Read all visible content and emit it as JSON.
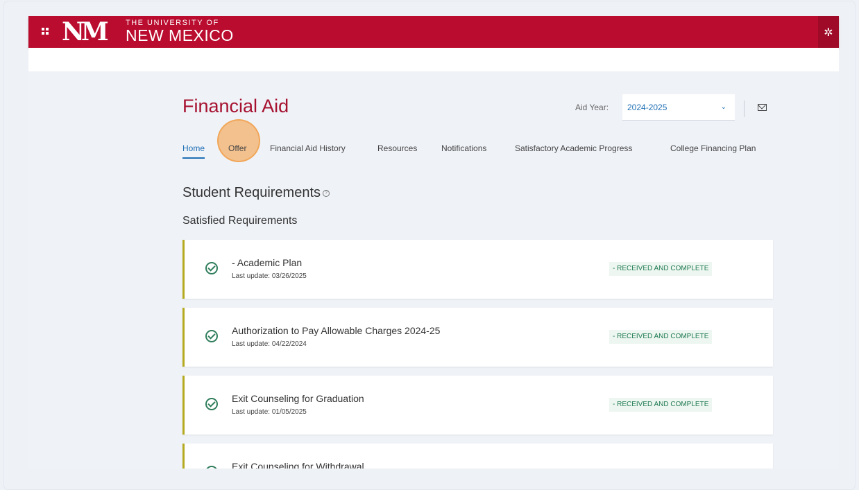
{
  "header": {
    "logo_mark": "NM",
    "logo_small": "THE UNIVERSITY OF",
    "logo_big": "NEW MEXICO"
  },
  "page": {
    "title": "Financial Aid",
    "aid_year_label": "Aid Year:",
    "aid_year_value": "2024-2025"
  },
  "tabs": [
    {
      "label": "Home",
      "active": true
    },
    {
      "label": "Offer",
      "active": false
    },
    {
      "label": "Financial Aid History",
      "active": false
    },
    {
      "label": "Resources",
      "active": false
    },
    {
      "label": "Notifications",
      "active": false
    },
    {
      "label": "Satisfactory Academic Progress",
      "active": false
    },
    {
      "label": "College Financing Plan",
      "active": false
    }
  ],
  "sections": {
    "title": "Student Requirements",
    "help_glyph": "?",
    "subtitle": "Satisfied Requirements"
  },
  "requirements": [
    {
      "name": "- Academic Plan",
      "updated": "Last update: 03/26/2025",
      "status": "- RECEIVED AND COMPLETE"
    },
    {
      "name": "Authorization to Pay Allowable Charges 2024-25",
      "updated": "Last update: 04/22/2024",
      "status": "- RECEIVED AND COMPLETE"
    },
    {
      "name": "Exit Counseling for Graduation",
      "updated": "Last update: 01/05/2025",
      "status": "- RECEIVED AND COMPLETE"
    },
    {
      "name": "Exit Counseling for Withdrawal",
      "updated": "",
      "status": ""
    }
  ],
  "icons": {
    "apps": "grid-icon",
    "settings": "gear-icon",
    "mail": "mail-icon",
    "dropdown": "chevron-down-icon",
    "check": "check-circle-icon"
  },
  "colors": {
    "brand_red": "#ba0c2f",
    "title_red": "#a6112f",
    "link_blue": "#1f6fb5",
    "success_green": "#1f7a52",
    "card_accent": "#b5a91f"
  }
}
